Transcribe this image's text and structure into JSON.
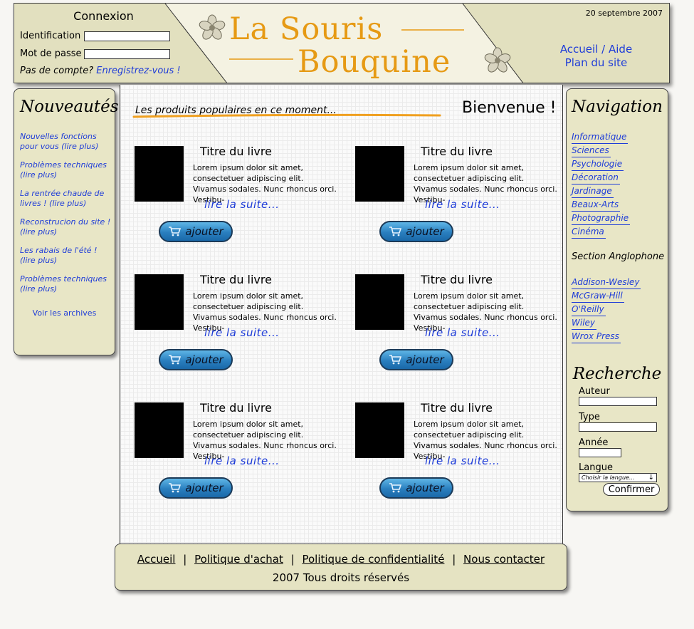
{
  "header": {
    "login": {
      "title": "Connexion",
      "id_label": "Identification",
      "pw_label": "Mot de passe",
      "no_account": "Pas de compte?",
      "register_link": "Enregistrez-vous !"
    },
    "logo": {
      "line1": "La Souris",
      "line2": "Bouquine"
    },
    "date": "20 septembre 2007",
    "links": {
      "home": "Accueil",
      "sep": "/",
      "help": "Aide",
      "sitemap": "Plan du site"
    }
  },
  "left": {
    "title": "Nouveautés",
    "news": [
      "Nouvelles fonctions pour vous (lire plus)",
      "Problèmes techniques (lire plus)",
      "La rentrée chaude de livres ! (lire plus)",
      "Reconstrucion du site ! (lire plus)",
      "Les rabais de l'été ! (lire plus)",
      "Problèmes techniques (lire plus)"
    ],
    "archives": "Voir les archives"
  },
  "main": {
    "subtitle": "Les produits populaires en ce moment...",
    "welcome": "Bienvenue !",
    "books": [
      {
        "title": "Titre du livre",
        "desc": "Lorem ipsum dolor sit amet, consectetuer adipiscing elit. Vivamus sodales. Nunc rhoncus orci. Vestibu-",
        "more": "lire la suite...",
        "add": "ajouter"
      },
      {
        "title": "Titre du livre",
        "desc": "Lorem ipsum dolor sit amet, consectetuer adipiscing elit. Vivamus sodales. Nunc rhoncus orci. Vestibu-",
        "more": "lire la suite...",
        "add": "ajouter"
      },
      {
        "title": "Titre du livre",
        "desc": "Lorem ipsum dolor sit amet, consectetuer adipiscing elit. Vivamus sodales. Nunc rhoncus orci. Vestibu-",
        "more": "lire la suite...",
        "add": "ajouter"
      },
      {
        "title": "Titre du livre",
        "desc": "Lorem ipsum dolor sit amet, consectetuer adipiscing elit. Vivamus sodales. Nunc rhoncus orci. Vestibu-",
        "more": "lire la suite...",
        "add": "ajouter"
      },
      {
        "title": "Titre du livre",
        "desc": "Lorem ipsum dolor sit amet, consectetuer adipiscing elit. Vivamus sodales. Nunc rhoncus orci. Vestibu-",
        "more": "lire la suite...",
        "add": "ajouter"
      },
      {
        "title": "Titre du livre",
        "desc": "Lorem ipsum dolor sit amet, consectetuer adipiscing elit. Vivamus sodales. Nunc rhoncus orci. Vestibu-",
        "more": "lire la suite...",
        "add": "ajouter"
      }
    ]
  },
  "right": {
    "nav_title": "Navigation",
    "categories": [
      "Informatique",
      "Sciences",
      "Psychologie",
      "Décoration",
      "Jardinage",
      "Beaux-Arts",
      "Photographie",
      "Cinéma"
    ],
    "anglo_title": "Section Anglophone",
    "publishers": [
      "Addison-Wesley",
      "McGraw-Hill",
      "O'Reilly",
      "Wiley",
      "Wrox Press"
    ],
    "search": {
      "title": "Recherche",
      "author": "Auteur",
      "type": "Type",
      "year": "Année",
      "lang": "Langue",
      "lang_placeholder": "Choisir la langue...",
      "confirm": "Confirmer"
    }
  },
  "footer": {
    "links": [
      "Accueil",
      "Politique d'achat",
      "Politique de confidentialité",
      "Nous contacter"
    ],
    "sep": "|",
    "copyright": "2007 Tous droits réservés"
  },
  "colors": {
    "link": "#1e3cd8",
    "panel": "#e5e3c2",
    "logo": "#e69a14",
    "button": "#2a7fbf"
  }
}
